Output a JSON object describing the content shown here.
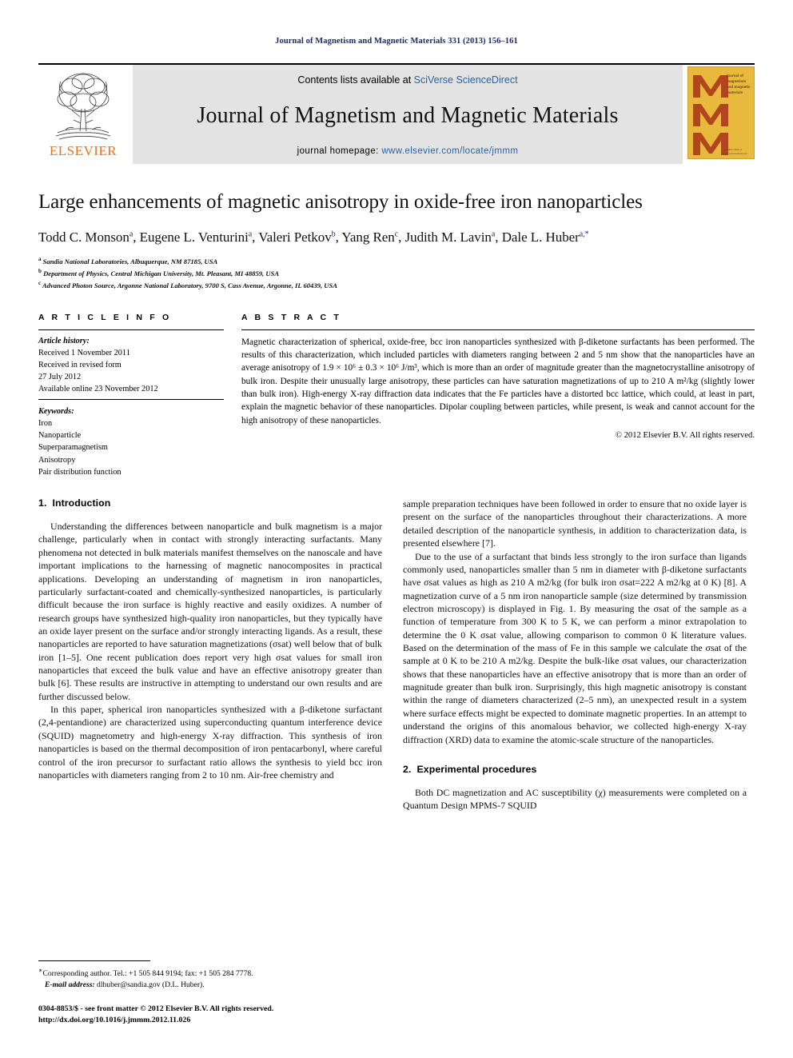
{
  "running_head": "Journal of Magnetism and Magnetic Materials 331 (2013) 156–161",
  "masthead": {
    "publisher_name": "ELSEVIER",
    "contents_prefix": "Contents lists available at ",
    "contents_link": "SciVerse ScienceDirect",
    "journal_name": "Journal of Magnetism and Magnetic Materials",
    "homepage_prefix": "journal homepage: ",
    "homepage_url": "www.elsevier.com/locate/jmmm",
    "cover": {
      "title_lines": "journal of magnetism and magnetic materials",
      "foot_lines": "available online at www.sciencedirect.com",
      "bg_color": "#E8B93C",
      "letter_color": "#B1461E"
    }
  },
  "title": "Large enhancements of magnetic anisotropy in oxide-free iron nanoparticles",
  "authors": [
    {
      "name": "Todd C. Monson",
      "sup": "a"
    },
    {
      "name": "Eugene L. Venturini",
      "sup": "a"
    },
    {
      "name": "Valeri Petkov",
      "sup": "b"
    },
    {
      "name": "Yang Ren",
      "sup": "c"
    },
    {
      "name": "Judith M. Lavin",
      "sup": "a"
    },
    {
      "name": "Dale L. Huber",
      "sup": "a,*"
    }
  ],
  "affiliations": [
    {
      "sup": "a",
      "text": "Sandia National Laboratories, Albuquerque, NM 87185, USA"
    },
    {
      "sup": "b",
      "text": "Department of Physics, Central Michigan University, Mt. Pleasant, MI 48859, USA"
    },
    {
      "sup": "c",
      "text": "Advanced Photon Source, Argonne National Laboratory, 9700 S, Cass Avenue, Argonne, IL 60439, USA"
    }
  ],
  "article_info": {
    "heading": "A R T I C L E  I N F O",
    "history_label": "Article history:",
    "history_lines": [
      "Received 1 November 2011",
      "Received in revised form",
      "27 July 2012",
      "Available online 23 November 2012"
    ],
    "keywords_label": "Keywords:",
    "keywords": [
      "Iron",
      "Nanoparticle",
      "Superparamagnetism",
      "Anisotropy",
      "Pair distribution function"
    ]
  },
  "abstract": {
    "heading": "A B S T R A C T",
    "paragraphs": [
      "Magnetic characterization of spherical, oxide-free, bcc iron nanoparticles synthesized with β-diketone surfactants has been performed. The results of this characterization, which included particles with diameters ranging between 2 and 5 nm show that the nanoparticles have an average anisotropy of 1.9 × 10⁶ ± 0.3 × 10⁶ J/m³, which is more than an order of magnitude greater than the magnetocrystalline anisotropy of bulk iron. Despite their unusually large anisotropy, these particles can have saturation magnetizations of up to 210 A m²/kg (slightly lower than bulk iron). High-energy X-ray diffraction data indicates that the Fe particles have a distorted bcc lattice, which could, at least in part, explain the magnetic behavior of these nanoparticles. Dipolar coupling between particles, while present, is weak and cannot account for the high anisotropy of these nanoparticles."
    ],
    "copyright": "© 2012 Elsevier B.V. All rights reserved."
  },
  "sections": {
    "introduction": {
      "number": "1.",
      "title": "Introduction",
      "paragraphs": [
        "Understanding the differences between nanoparticle and bulk magnetism is a major challenge, particularly when in contact with strongly interacting surfactants. Many phenomena not detected in bulk materials manifest themselves on the nanoscale and have important implications to the harnessing of magnetic nanocomposites in practical applications. Developing an understanding of magnetism in iron nanoparticles, particularly surfactant-coated and chemically-synthesized nanoparticles, is particularly difficult because the iron surface is highly reactive and easily oxidizes. A number of research groups have synthesized high-quality iron nanoparticles, but they typically have an oxide layer present on the surface and/or strongly interacting ligands. As a result, these nanoparticles are reported to have saturation magnetizations (σsat) well below that of bulk iron [1–5]. One recent publication does report very high σsat values for small iron nanoparticles that exceed the bulk value and have an effective anisotropy greater than bulk [6]. These results are instructive in attempting to understand our own results and are further discussed below.",
        "In this paper, spherical iron nanoparticles synthesized with a β-diketone surfactant (2,4-pentandione) are characterized using superconducting quantum interference device (SQUID) magnetometry and high-energy X-ray diffraction. This synthesis of iron nanoparticles is based on the thermal decomposition of iron pentacarbonyl, where careful control of the iron precursor to surfactant ratio allows the synthesis to yield bcc iron nanoparticles with diameters ranging from 2 to 10 nm. Air-free chemistry and"
      ]
    },
    "right_column": {
      "continued_paragraph": "sample preparation techniques have been followed in order to ensure that no oxide layer is present on the surface of the nanoparticles throughout their characterizations. A more detailed description of the nanoparticle synthesis, in addition to characterization data, is presented elsewhere [7].",
      "paragraph_2": "Due to the use of a surfactant that binds less strongly to the iron surface than ligands commonly used, nanoparticles smaller than 5 nm in diameter with β-diketone surfactants have σsat values as high as 210 A m2/kg (for bulk iron σsat=222 A m2/kg at 0 K) [8]. A magnetization curve of a 5 nm iron nanoparticle sample (size determined by transmission electron microscopy) is displayed in Fig. 1. By measuring the σsat of the sample as a function of temperature from 300 K to 5 K, we can perform a minor extrapolation to determine the 0 K σsat value, allowing comparison to common 0 K literature values. Based on the determination of the mass of Fe in this sample we calculate the σsat of the sample at 0 K to be 210 A m2/kg. Despite the bulk-like σsat values, our characterization shows that these nanoparticles have an effective anisotropy that is more than an order of magnitude greater than bulk iron. Surprisingly, this high magnetic anisotropy is constant within the range of diameters characterized (2–5 nm), an unexpected result in a system where surface effects might be expected to dominate magnetic properties. In an attempt to understand the origins of this anomalous behavior, we collected high-energy X-ray diffraction (XRD) data to examine the atomic-scale structure of the nanoparticles."
    },
    "experimental": {
      "number": "2.",
      "title": "Experimental procedures",
      "paragraph": "Both DC magnetization and AC susceptibility (χ) measurements were completed on a Quantum Design MPMS-7 SQUID"
    }
  },
  "footnote": {
    "corresponding": "Corresponding author. Tel.: +1 505 844 9194; fax: +1 505 284 7778.",
    "email_label": "E-mail address:",
    "email": "dlhuber@sandia.gov (D.L. Huber).",
    "issn_line": "0304-8853/$ - see front matter © 2012 Elsevier B.V. All rights reserved.",
    "doi_line": "http://dx.doi.org/10.1016/j.jmmm.2012.11.026"
  }
}
